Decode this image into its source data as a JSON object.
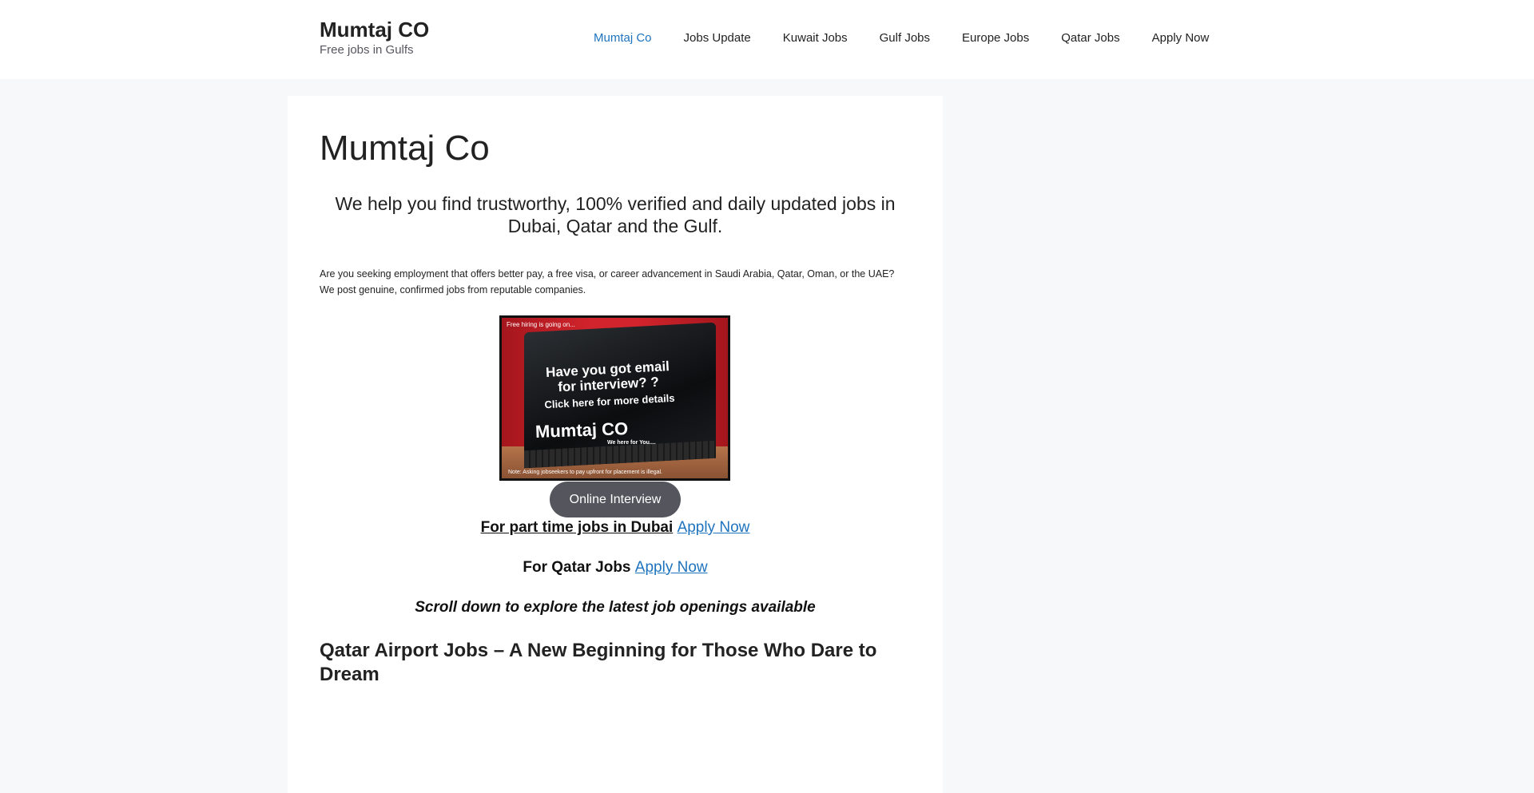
{
  "header": {
    "site_title": "Mumtaj CO",
    "site_description": "Free jobs in Gulfs"
  },
  "nav": {
    "items": [
      {
        "label": "Mumtaj Co",
        "active": true
      },
      {
        "label": "Jobs Update"
      },
      {
        "label": "Kuwait Jobs"
      },
      {
        "label": "Gulf Jobs"
      },
      {
        "label": "Europe Jobs"
      },
      {
        "label": "Qatar Jobs"
      },
      {
        "label": "Apply Now"
      }
    ]
  },
  "main": {
    "page_title": "Mumtaj Co",
    "lead": "We help you find trustworthy, 100% verified and daily updated jobs in Dubai, Qatar and the Gulf.",
    "intro": "Are you seeking employment that offers better pay, a free visa, or career advancement in Saudi Arabia, Qatar, Oman, or the UAE? We post genuine, confirmed jobs from reputable companies.",
    "hero_image": {
      "top_text": "Free hiring is going on...",
      "question": "Have you got email for interview? ?",
      "click_text": "Click here for more details",
      "brand": "Mumtaj CO",
      "tagline": "We here for You....",
      "note": "Note: Asking jobseekers to pay upfront for placement is illegal."
    },
    "interview_button": "Online Interview",
    "part_time": {
      "label": "For part time jobs in Dubai",
      "link": "Apply Now"
    },
    "qatar": {
      "label": "For Qatar Jobs",
      "link": "Apply Now"
    },
    "scroll_note": "Scroll down to explore the latest job openings available",
    "post_title": "Qatar Airport Jobs – A New Beginning for Those Who Dare to Dream"
  },
  "colors": {
    "link": "#1e73be",
    "button": "#55555e",
    "background": "#f7f8f9"
  }
}
